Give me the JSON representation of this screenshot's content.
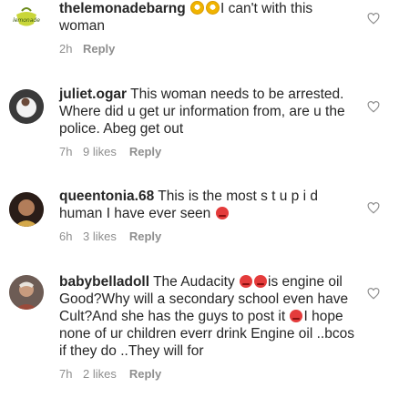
{
  "comments": [
    {
      "username": "thelemonadebarng",
      "emojis_before": [
        "flushed-face",
        "flushed-face"
      ],
      "text": "I can't with this woman",
      "time": "2h",
      "likes": "",
      "reply": "Reply",
      "avatar": "lemonade-logo-avatar"
    },
    {
      "username": "juliet.ogar",
      "text": "This woman needs to be arrested. Where did u get ur information from, are u the police. Abeg get out",
      "time": "7h",
      "likes": "9 likes",
      "reply": "Reply",
      "avatar": "person-avatar"
    },
    {
      "username": "queentonia.68",
      "text": "This is the most s t u p i d human I have ever seen",
      "emoji_after": "angry-face",
      "time": "6h",
      "likes": "3 likes",
      "reply": "Reply",
      "avatar": "person-avatar"
    },
    {
      "username": "babybelladoll",
      "text_part1": "The Audacity",
      "text_part2": "is engine oil Good?Why will a secondary school even have Cult?And she has the guys to post it",
      "text_part3": "I hope none of ur children everr drink Engine oil ..bcos if they do ..They will for",
      "time": "7h",
      "likes": "2 likes",
      "reply": "Reply",
      "avatar": "person-avatar"
    }
  ],
  "colors": {
    "text": "#262626",
    "meta": "#8e8e8e",
    "heart_stroke": "#8e8e8e"
  }
}
